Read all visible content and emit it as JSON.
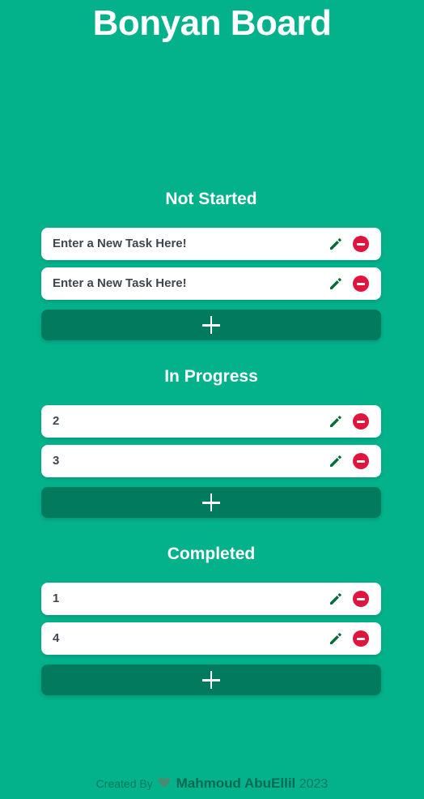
{
  "app": {
    "title": "Bonyan Board"
  },
  "columns": [
    {
      "title": "Not Started",
      "tasks": [
        "Enter a New Task Here!",
        "Enter a New Task Here!"
      ]
    },
    {
      "title": "In Progress",
      "tasks": [
        "2",
        "3"
      ]
    },
    {
      "title": "Completed",
      "tasks": [
        "1",
        "4"
      ]
    }
  ],
  "icons": {
    "edit": "pencil-icon",
    "delete": "minus-circle-icon",
    "add": "plus-icon"
  },
  "colors": {
    "background": "#03b18a",
    "add_button": "#027a5d",
    "edit_icon": "#0a6b3a",
    "delete_icon": "#e0143c"
  },
  "footer": {
    "created_by": "Created By",
    "author": "Mahmoud AbuEllil",
    "year": "2023"
  }
}
